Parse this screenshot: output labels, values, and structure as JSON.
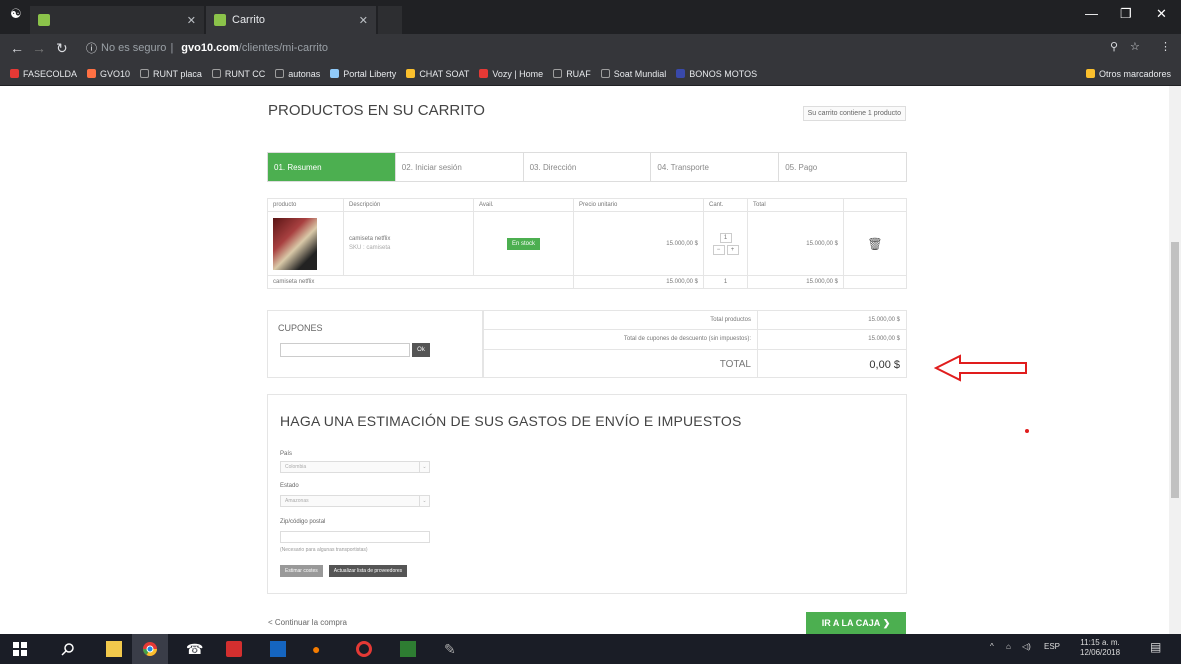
{
  "browser": {
    "tabs": [
      {
        "label": "",
        "active": false
      },
      {
        "label": "Carrito",
        "active": true
      }
    ],
    "address": {
      "security": "No es seguro",
      "domain": "gvo10.com",
      "path": "/clientes/mi-carrito"
    },
    "bookmarks": [
      {
        "label": "FASECOLDA",
        "color": "#e53935"
      },
      {
        "label": "GVO10",
        "color": "#ff7043"
      },
      {
        "label": "RUNT placa",
        "color": "#9e9e9e"
      },
      {
        "label": "RUNT CC",
        "color": "#9e9e9e"
      },
      {
        "label": "autonas",
        "color": "#9e9e9e"
      },
      {
        "label": "Portal Liberty",
        "color": "#f9a825"
      },
      {
        "label": "CHAT SOAT",
        "color": "#fbc02d"
      },
      {
        "label": "Vozy | Home",
        "color": "#e53935"
      },
      {
        "label": "RUAF",
        "color": "#9e9e9e"
      },
      {
        "label": "Soat Mundial",
        "color": "#9e9e9e"
      },
      {
        "label": "BONOS MOTOS",
        "color": "#3949ab"
      }
    ],
    "other_bookmarks": "Otros marcadores"
  },
  "cart": {
    "title": "PRODUCTOS EN SU CARRITO",
    "count_text": "Su carrito contiene 1 producto",
    "steps": [
      {
        "label": "01. Resumen",
        "active": true
      },
      {
        "label": "02. Iniciar sesión",
        "active": false
      },
      {
        "label": "03. Dirección",
        "active": false
      },
      {
        "label": "04. Transporte",
        "active": false
      },
      {
        "label": "05. Pago",
        "active": false
      }
    ],
    "table": {
      "headers": [
        "producto",
        "Descripción",
        "Avail.",
        "Precio unitario",
        "Cant.",
        "Total"
      ],
      "item": {
        "name": "camiseta netflix",
        "sku": "SKU : camiseta",
        "avail": "En stock",
        "price": "15.000,00 $",
        "qty": "1",
        "total": "15.000,00 $"
      },
      "summary": {
        "name": "camiseta netflix",
        "price": "15.000,00 $",
        "qty": "1",
        "total": "15.000,00 $"
      }
    },
    "coupons": {
      "label": "CUPONES",
      "button": "Ok"
    },
    "totals": [
      {
        "label": "Total productos",
        "value": "15.000,00 $"
      },
      {
        "label": "Total de cupones de descuento (sin impuestos):",
        "value": "15.000,00 $"
      },
      {
        "label": "TOTAL",
        "value": "0,00 $"
      }
    ],
    "estimate": {
      "title": "HAGA UNA ESTIMACIÓN DE SUS GASTOS DE ENVÍO E IMPUESTOS",
      "country_label": "País",
      "country_value": "Colombia",
      "state_label": "Estado",
      "state_value": "Amazonas",
      "zip_label": "Zip/código postal",
      "hint": "(Necesario para algunas transportistas)",
      "btn_estimate": "Estimar costes",
      "btn_update": "Actualizar lista de proveedores"
    },
    "continue": "< Continuar la compra",
    "checkout": "IR A LA CAJA"
  },
  "taskbar": {
    "time": "11:15 a. m.",
    "date": "12/06/2018",
    "lang": "ESP"
  }
}
